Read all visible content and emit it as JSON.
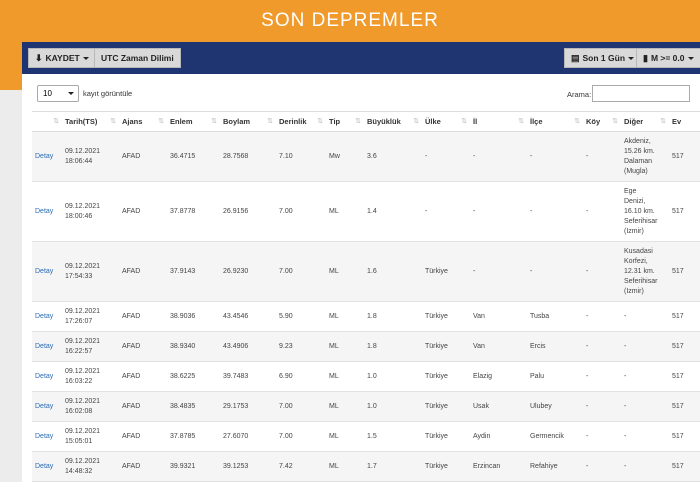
{
  "header": {
    "title": "SON DEPREMLER"
  },
  "toolbar": {
    "save_label": "KAYDET",
    "utc_label": "UTC Zaman Dilimi",
    "period_label": "Son 1 Gün",
    "magnitude_label": "M >= 0.0"
  },
  "controls": {
    "page_size": "10",
    "page_size_suffix": "kayıt görüntüle",
    "search_label": "Arama:",
    "search_value": ""
  },
  "table": {
    "headers": [
      "",
      "Tarih(TS)",
      "Ajans",
      "Enlem",
      "Boylam",
      "Derinlik",
      "Tip",
      "Büyüklük",
      "Ülke",
      "İl",
      "İlçe",
      "Köy",
      "Diğer",
      "Ev"
    ],
    "rows": [
      {
        "detail": "Detay",
        "date": "09.12.2021",
        "time": "18:06:44",
        "agency": "AFAD",
        "lat": "36.4715",
        "lon": "28.7568",
        "depth": "7.10",
        "type": "Mw",
        "mag": "3.6",
        "country": "-",
        "province": "-",
        "district": "-",
        "village": "-",
        "other": [
          "Akdeniz,",
          "15.26 km.",
          "Dalaman",
          "(Mugla)"
        ],
        "event": "517"
      },
      {
        "detail": "Detay",
        "date": "09.12.2021",
        "time": "18:00:46",
        "agency": "AFAD",
        "lat": "37.8778",
        "lon": "26.9156",
        "depth": "7.00",
        "type": "ML",
        "mag": "1.4",
        "country": "-",
        "province": "-",
        "district": "-",
        "village": "-",
        "other": [
          "Ege",
          "Denizi,",
          "16.10 km.",
          "Seferihisar",
          "(Izmir)"
        ],
        "event": "517"
      },
      {
        "detail": "Detay",
        "date": "09.12.2021",
        "time": "17:54:33",
        "agency": "AFAD",
        "lat": "37.9143",
        "lon": "26.9230",
        "depth": "7.00",
        "type": "ML",
        "mag": "1.6",
        "country": "Türkiye",
        "province": "-",
        "district": "-",
        "village": "-",
        "other": [
          "Kusadasi",
          "Korfezi,",
          "12.31 km.",
          "Seferihisar",
          "(Izmir)"
        ],
        "event": "517"
      },
      {
        "detail": "Detay",
        "date": "09.12.2021",
        "time": "17:26:07",
        "agency": "AFAD",
        "lat": "38.9036",
        "lon": "43.4546",
        "depth": "5.90",
        "type": "ML",
        "mag": "1.8",
        "country": "Türkiye",
        "province": "Van",
        "district": "Tusba",
        "village": "-",
        "other": [
          "-"
        ],
        "event": "517"
      },
      {
        "detail": "Detay",
        "date": "09.12.2021",
        "time": "16:22:57",
        "agency": "AFAD",
        "lat": "38.9340",
        "lon": "43.4906",
        "depth": "9.23",
        "type": "ML",
        "mag": "1.8",
        "country": "Türkiye",
        "province": "Van",
        "district": "Ercis",
        "village": "-",
        "other": [
          "-"
        ],
        "event": "517"
      },
      {
        "detail": "Detay",
        "date": "09.12.2021",
        "time": "16:03:22",
        "agency": "AFAD",
        "lat": "38.6225",
        "lon": "39.7483",
        "depth": "6.90",
        "type": "ML",
        "mag": "1.0",
        "country": "Türkiye",
        "province": "Elazig",
        "district": "Palu",
        "village": "-",
        "other": [
          "-"
        ],
        "event": "517"
      },
      {
        "detail": "Detay",
        "date": "09.12.2021",
        "time": "16:02:08",
        "agency": "AFAD",
        "lat": "38.4835",
        "lon": "29.1753",
        "depth": "7.00",
        "type": "ML",
        "mag": "1.0",
        "country": "Türkiye",
        "province": "Usak",
        "district": "Ulubey",
        "village": "-",
        "other": [
          "-"
        ],
        "event": "517"
      },
      {
        "detail": "Detay",
        "date": "09.12.2021",
        "time": "15:05:01",
        "agency": "AFAD",
        "lat": "37.8785",
        "lon": "27.6070",
        "depth": "7.00",
        "type": "ML",
        "mag": "1.5",
        "country": "Türkiye",
        "province": "Aydin",
        "district": "Germencik",
        "village": "-",
        "other": [
          "-"
        ],
        "event": "517"
      },
      {
        "detail": "Detay",
        "date": "09.12.2021",
        "time": "14:48:32",
        "agency": "AFAD",
        "lat": "39.9321",
        "lon": "39.1253",
        "depth": "7.42",
        "type": "ML",
        "mag": "1.7",
        "country": "Türkiye",
        "province": "Erzincan",
        "district": "Refahiye",
        "village": "-",
        "other": [
          "-"
        ],
        "event": "517"
      }
    ]
  }
}
